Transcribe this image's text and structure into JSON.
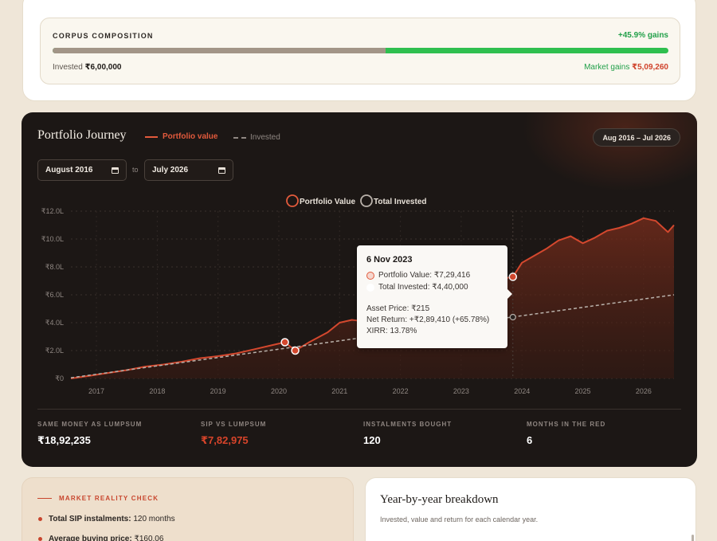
{
  "corpus": {
    "title": "CORPUS COMPOSITION",
    "gains": "+45.9% gains",
    "invested_label": "Invested",
    "invested_value": "₹6,00,000",
    "market_label": "Market gains",
    "market_value": "₹5,09,260",
    "invested_fraction": 0.541,
    "colors": {
      "invested": "#a29587",
      "gains": "#2fbf4f"
    }
  },
  "journey": {
    "title": "Portfolio Journey",
    "legend_portfolio": "Portfolio value",
    "legend_invested": "Invested",
    "range": "Aug 2016 – Jul 2026",
    "from_date": "August 2016",
    "to_label": "to",
    "to_date": "July 2026"
  },
  "chart_data": {
    "type": "area",
    "legend": [
      "Portfolio Value",
      "Total Invested"
    ],
    "legend_placement": "top-center",
    "xlim": [
      2016.58,
      2026.5
    ],
    "ylim": [
      0,
      12
    ],
    "x_ticks": [
      "2017",
      "2018",
      "2019",
      "2020",
      "2021",
      "2022",
      "2023",
      "2024",
      "2025",
      "2026"
    ],
    "x_tick_values": [
      2017,
      2018,
      2019,
      2020,
      2021,
      2022,
      2023,
      2024,
      2025,
      2026
    ],
    "y_ticks": [
      "₹0",
      "₹2.0L",
      "₹4.0L",
      "₹6.0L",
      "₹8.0L",
      "₹10.0L",
      "₹12.0L"
    ],
    "y_tick_values": [
      0,
      2,
      4,
      6,
      8,
      10,
      12
    ],
    "grid": true,
    "series": [
      {
        "name": "Portfolio Value",
        "color": "#d4482e",
        "x": [
          2016.58,
          2016.9,
          2017.2,
          2017.5,
          2017.8,
          2018.1,
          2018.4,
          2018.7,
          2019.0,
          2019.3,
          2019.6,
          2019.9,
          2020.1,
          2020.27,
          2020.5,
          2020.8,
          2021.0,
          2021.2,
          2021.4,
          2021.7,
          2022.0,
          2022.3,
          2022.6,
          2022.9,
          2023.2,
          2023.5,
          2023.85,
          2024.0,
          2024.2,
          2024.4,
          2024.6,
          2024.8,
          2025.0,
          2025.2,
          2025.4,
          2025.6,
          2025.8,
          2026.0,
          2026.2,
          2026.4,
          2026.5
        ],
        "values": [
          0.0,
          0.2,
          0.4,
          0.6,
          0.85,
          1.0,
          1.2,
          1.45,
          1.6,
          1.8,
          2.1,
          2.4,
          2.6,
          2.0,
          2.6,
          3.3,
          4.0,
          4.2,
          4.1,
          4.6,
          5.2,
          5.5,
          5.9,
          6.2,
          6.6,
          7.0,
          7.29,
          8.3,
          8.8,
          9.3,
          9.9,
          10.2,
          9.7,
          10.1,
          10.6,
          10.8,
          11.1,
          11.5,
          11.3,
          10.5,
          11.0
        ]
      },
      {
        "name": "Total Invested",
        "color": "#b9b1aa",
        "x": [
          2016.58,
          2026.5
        ],
        "values": [
          0.05,
          6.0
        ]
      }
    ],
    "annotations": [
      {
        "x": 2020.1,
        "y": 2.6
      },
      {
        "x": 2020.27,
        "y": 2.0
      },
      {
        "x": 2023.85,
        "y": 7.29
      },
      {
        "x": 2023.85,
        "y": 4.4
      }
    ]
  },
  "tooltip": {
    "date": "6 Nov 2023",
    "portfolio_value": "Portfolio Value: ₹7,29,416",
    "total_invested": "Total Invested: ₹4,40,000",
    "asset_price": "Asset Price: ₹215",
    "net_return": "Net Return: +₹2,89,410 (+65.78%)",
    "xirr": "XIRR: 13.78%"
  },
  "stats": [
    {
      "label": "SAME MONEY AS LUMPSUM",
      "value": "₹18,92,235"
    },
    {
      "label": "SIP VS LUMPSUM",
      "value": "₹7,82,975"
    },
    {
      "label": "INSTALMENTS BOUGHT",
      "value": "120"
    },
    {
      "label": "MONTHS IN THE RED",
      "value": "6"
    }
  ],
  "reality": {
    "title": "MARKET REALITY CHECK",
    "items": [
      {
        "label": "Total SIP instalments:",
        "value": "120 months"
      },
      {
        "label": "Average buying price:",
        "value": "₹160.06"
      }
    ]
  },
  "yoy": {
    "title": "Year-by-year breakdown",
    "subtitle": "Invested, value and return for each calendar year."
  }
}
